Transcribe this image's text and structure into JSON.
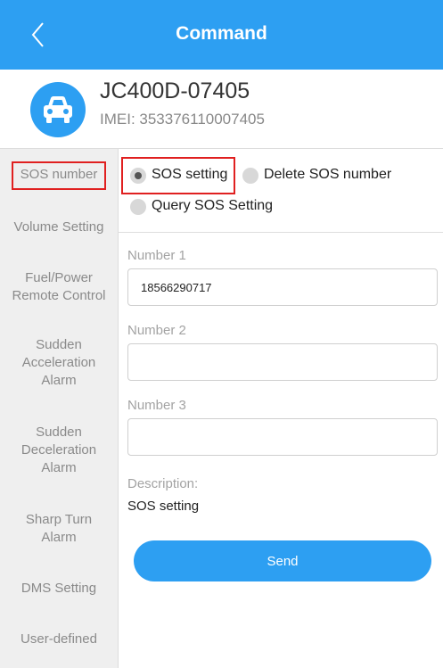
{
  "header": {
    "title": "Command",
    "back_icon": "chevron-left-icon"
  },
  "device": {
    "name": "JC400D-07405",
    "imei": "IMEI:  353376110007405",
    "icon": "car-icon"
  },
  "sidebar": {
    "items": [
      {
        "label": "SOS number",
        "active": true
      },
      {
        "label": "Volume Setting"
      },
      {
        "label": "Fuel/Power\nRemote Control"
      },
      {
        "label": "Sudden\nAcceleration\nAlarm"
      },
      {
        "label": "Sudden\nDeceleration\nAlarm"
      },
      {
        "label": "Sharp Turn\nAlarm"
      },
      {
        "label": "DMS Setting"
      },
      {
        "label": "User-defined"
      }
    ]
  },
  "options": {
    "sos_setting": "SOS setting",
    "delete_sos": "Delete SOS number",
    "query_sos": "Query SOS Setting",
    "selected": "sos_setting"
  },
  "form": {
    "number1_label": "Number 1",
    "number1_value": "18566290717",
    "number2_label": "Number 2",
    "number2_value": "",
    "number3_label": "Number 3",
    "number3_value": ""
  },
  "description": {
    "label": "Description:",
    "text": "SOS setting"
  },
  "send_label": "Send",
  "colors": {
    "primary": "#2d9ff2",
    "highlight": "#e02020"
  }
}
